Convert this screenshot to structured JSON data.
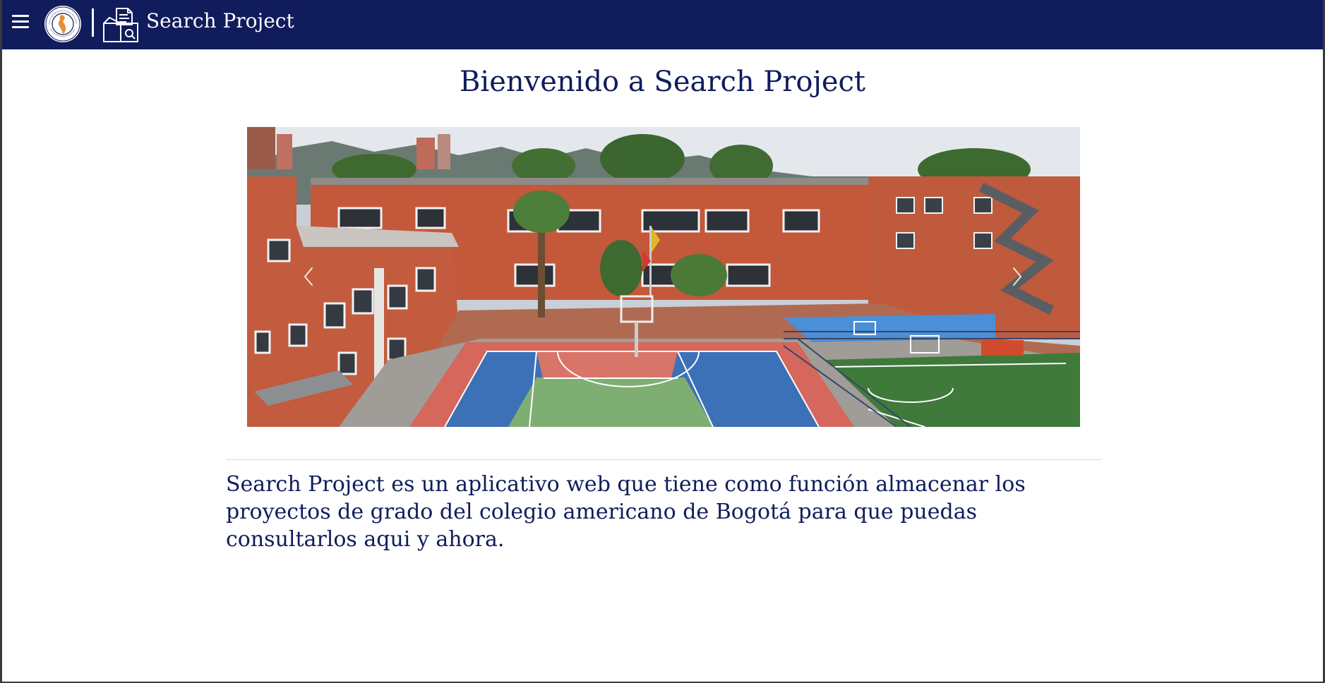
{
  "header": {
    "menu_icon": "hamburger-menu-icon",
    "logo_icon": "colegio-americano-de-bogota-logo",
    "logo_text": "COLEGIO AMERICANO DE BOGOTÁ",
    "app_icon": "search-project-document-box-icon",
    "app_title": "Search Project",
    "bar_color": "#101c5c"
  },
  "main": {
    "heading": "Bienvenido a Search Project",
    "carousel": {
      "image": "school-campus-aerial-photo",
      "prev_icon": "chevron-left-icon",
      "next_icon": "chevron-right-icon"
    },
    "description": "Search Project es un aplicativo web que tiene como función almacenar los proyectos de grado del colegio americano de Bogotá para que puedas consultarlos aqui y ahora.",
    "text_color": "#0f1d5c"
  }
}
